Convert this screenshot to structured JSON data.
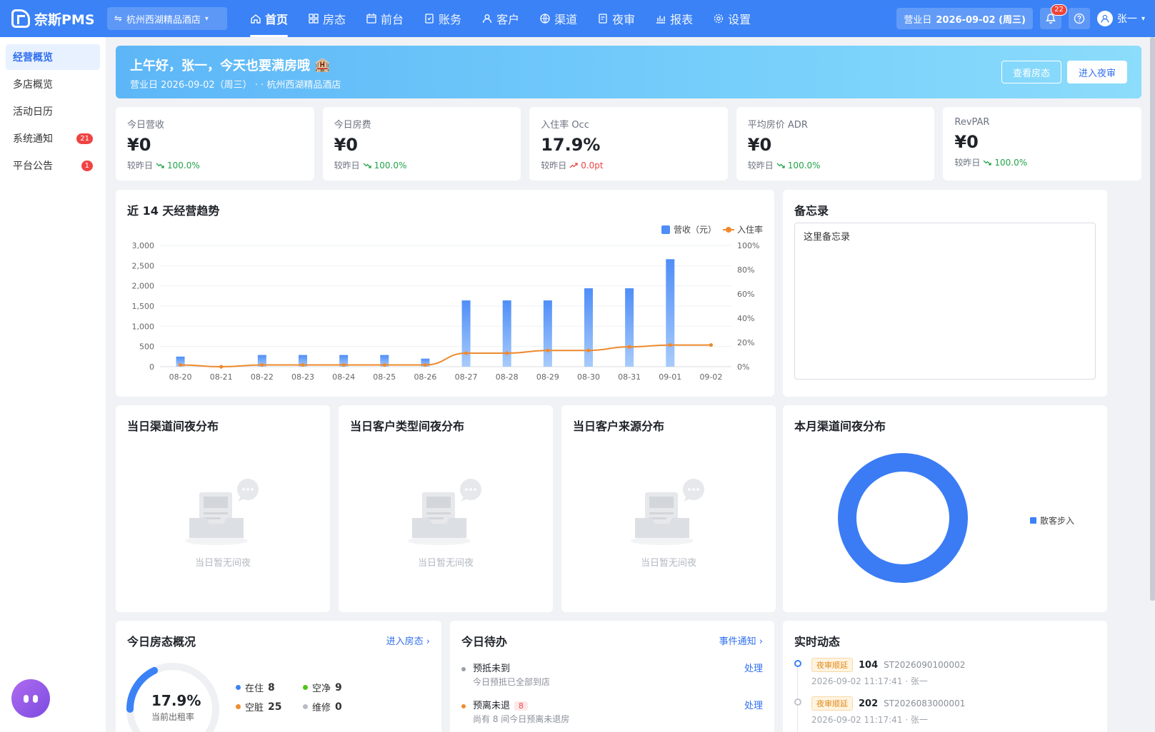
{
  "app": {
    "brand": "奈斯PMS",
    "hotel": "杭州西湖精品酒店"
  },
  "nav": [
    {
      "label": "首页",
      "icon": "home-icon",
      "active": true
    },
    {
      "label": "房态",
      "icon": "grid-icon"
    },
    {
      "label": "前台",
      "icon": "calendar-icon"
    },
    {
      "label": "账务",
      "icon": "ledger-icon"
    },
    {
      "label": "客户",
      "icon": "user-icon"
    },
    {
      "label": "渠道",
      "icon": "globe-icon"
    },
    {
      "label": "夜审",
      "icon": "audit-icon"
    },
    {
      "label": "报表",
      "icon": "bar-chart-icon"
    },
    {
      "label": "设置",
      "icon": "gear-icon"
    }
  ],
  "topright": {
    "bizdate_label": "营业日",
    "bizdate_value": "2026-09-02 (周三)",
    "notif_count": "22",
    "user": "张一"
  },
  "sidebar": [
    {
      "label": "经营概览",
      "active": true,
      "badge": ""
    },
    {
      "label": "多店概览",
      "badge": ""
    },
    {
      "label": "活动日历",
      "badge": ""
    },
    {
      "label": "系统通知",
      "badge": "21"
    },
    {
      "label": "平台公告",
      "badge": "1"
    }
  ],
  "banner": {
    "title": "上午好，张一，今天也要满房哦",
    "sub": "营业日 2026-09-02（周三） · · 杭州西湖精品酒店",
    "btn_rooms": "查看房态",
    "btn_audit": "进入夜审"
  },
  "kpis": [
    {
      "label": "今日营收",
      "value": "¥0",
      "cmp_label": "较昨日",
      "cmp": "100.0%",
      "dir": "down"
    },
    {
      "label": "今日房费",
      "value": "¥0",
      "cmp_label": "较昨日",
      "cmp": "100.0%",
      "dir": "down"
    },
    {
      "label": "入住率 Occ",
      "value": "17.9%",
      "cmp_label": "较昨日",
      "cmp": "0.0pt",
      "dir": "up"
    },
    {
      "label": "平均房价 ADR",
      "value": "¥0",
      "cmp_label": "较昨日",
      "cmp": "100.0%",
      "dir": "down"
    },
    {
      "label": "RevPAR",
      "value": "¥0",
      "cmp_label": "较昨日",
      "cmp": "100.0%",
      "dir": "down"
    }
  ],
  "trend": {
    "title": "近 14 天经营趋势"
  },
  "memo": {
    "title": "备忘录",
    "text": "这里备忘录"
  },
  "dist": [
    {
      "title": "当日渠道间夜分布",
      "empty": "当日暂无间夜"
    },
    {
      "title": "当日客户类型间夜分布",
      "empty": "当日暂无间夜"
    },
    {
      "title": "当日客户来源分布",
      "empty": "当日暂无间夜"
    }
  ],
  "month_dist": {
    "title": "本月渠道间夜分布",
    "legend": "散客步入"
  },
  "room_overview": {
    "title": "今日房态概况",
    "link": "进入房态",
    "occ": "17.9%",
    "occ_label": "当前出租率",
    "stats": [
      {
        "label": "在住",
        "value": "8",
        "color": "#3b82f6"
      },
      {
        "label": "空净",
        "value": "9",
        "color": "#52c41a"
      },
      {
        "label": "空脏",
        "value": "25",
        "color": "#f08c2e"
      },
      {
        "label": "维修",
        "value": "0",
        "color": "#b8bcc4"
      }
    ]
  },
  "todo": {
    "title": "今日待办",
    "link": "事件通知",
    "items": [
      {
        "main": "预抵未到",
        "sub": "今日预抵已全部到店",
        "action": "处理",
        "badge": "",
        "color": "#9aa0a8"
      },
      {
        "main": "预离未退",
        "sub": "尚有 8 间今日预离未退房",
        "action": "处理",
        "badge": "8",
        "color": "#f08c2e"
      }
    ]
  },
  "activity": {
    "title": "实时动态",
    "items": [
      {
        "tag": "夜审顺延",
        "room": "104",
        "no": "ST2026090100002",
        "time": "2026-09-02 11:17:41 · 张一"
      },
      {
        "tag": "夜审顺延",
        "room": "202",
        "no": "ST2026083000001",
        "time": "2026-09-02 11:17:41 · 张一"
      }
    ]
  },
  "chart_data": {
    "type": "bar",
    "categories": [
      "08-20",
      "08-21",
      "08-22",
      "08-23",
      "08-24",
      "08-25",
      "08-26",
      "08-27",
      "08-28",
      "08-29",
      "08-30",
      "08-31",
      "09-01",
      "09-02"
    ],
    "series": [
      {
        "name": "营收（元）",
        "type": "bar",
        "axis": "left",
        "color": "#4f8ef7",
        "values": [
          250,
          0,
          290,
          290,
          290,
          290,
          200,
          1640,
          1640,
          1640,
          1940,
          1940,
          2660,
          0
        ]
      },
      {
        "name": "入住率",
        "type": "line",
        "axis": "right",
        "color": "#ee8a2e",
        "values": [
          1.5,
          0,
          1.5,
          1.5,
          1.5,
          1.5,
          1.5,
          11.2,
          11.2,
          13.4,
          13.4,
          16.4,
          17.9,
          17.9
        ]
      }
    ],
    "ylim_left": [
      0,
      3000
    ],
    "yticks_left": [
      "0",
      "500",
      "1,000",
      "1,500",
      "2,000",
      "2,500",
      "3,000"
    ],
    "ylim_right": [
      0,
      100
    ],
    "yticks_right": [
      "0%",
      "20%",
      "40%",
      "60%",
      "80%",
      "100%"
    ],
    "legend_position": "top-right",
    "grid": true
  },
  "month_chart": {
    "type": "pie",
    "categories": [
      "散客步入"
    ],
    "values": [
      100
    ],
    "color": "#3b7cf5"
  }
}
